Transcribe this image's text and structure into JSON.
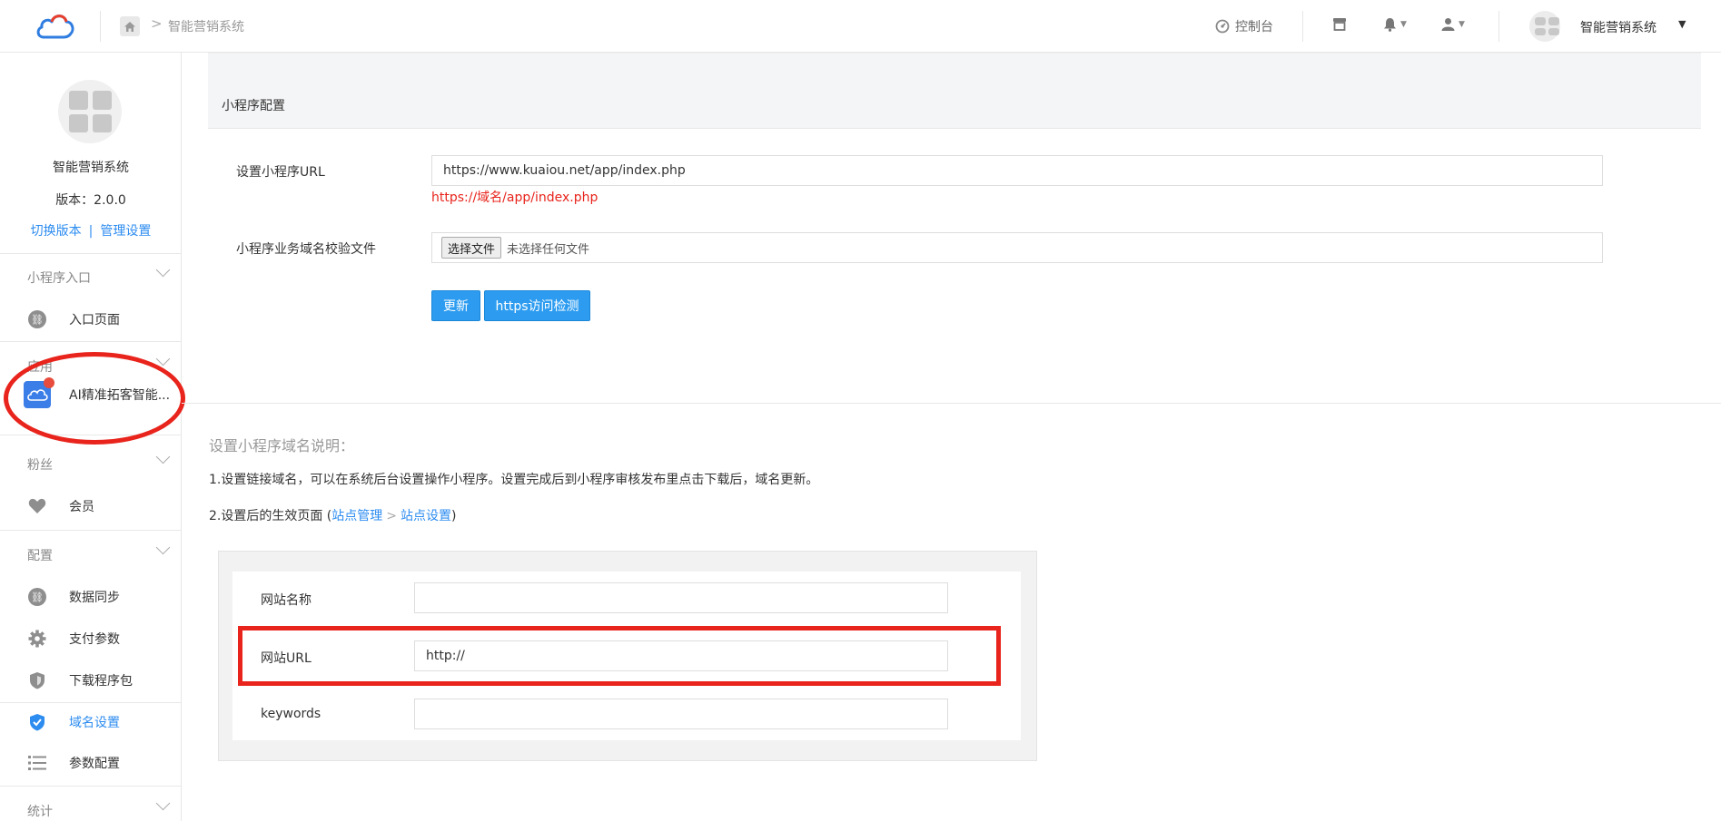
{
  "topbar": {
    "breadcrumb": "智能营销系统",
    "console_label": "控制台",
    "system_name": "智能营销系统",
    "icons": [
      "cloud-logo-icon",
      "home-icon",
      "dashboard-icon",
      "store-icon",
      "bell-icon",
      "user-icon",
      "caret-down-icon"
    ]
  },
  "sidebar": {
    "system_name": "智能营销系统",
    "version": "版本：2.0.0",
    "switch_version": "切换版本",
    "link_separator": "|",
    "manage_settings": "管理设置",
    "groups": {
      "entry": "小程序入口",
      "app": "应用",
      "fans": "粉丝",
      "config": "配置",
      "stats": "统计"
    },
    "items": {
      "entry_page": "入口页面",
      "ai_app": "AI精准拓客智能...",
      "member": "会员",
      "data_sync": "数据同步",
      "pay_params": "支付参数",
      "download_pkg": "下载程序包",
      "domain_settings": "域名设置",
      "param_config": "参数配置"
    }
  },
  "main": {
    "panel_title": "小程序配置",
    "url_label": "设置小程序URL",
    "url_value": "https://www.kuaiou.net/app/index.php",
    "url_hint": "https://域名/app/index.php",
    "verify_label": "小程序业务域名校验文件",
    "choose_file": "选择文件",
    "no_file": "未选择任何文件",
    "update_button": "更新",
    "https_check_button": "https访问检测"
  },
  "description": {
    "title": "设置小程序域名说明：",
    "line1": "1.设置链接域名，可以在系统后台设置操作小程序。设置完成后到小程序审核发布里点击下载后，域名更新。",
    "line2_prefix": "2.设置后的生效页面 (",
    "link_site_manage": "站点管理",
    "arrow": ">",
    "link_site_settings": "站点设置",
    "line2_suffix": ")"
  },
  "demo": {
    "site_name_label": "网站名称",
    "site_name_value": "",
    "site_url_label": "网站URL",
    "site_url_value": "http://",
    "keywords_label": "keywords",
    "keywords_value": ""
  },
  "colors": {
    "accent": "#2d8cf0",
    "button": "#2d9cf0",
    "annotation": "#e8241c",
    "hint": "#e8241c"
  }
}
